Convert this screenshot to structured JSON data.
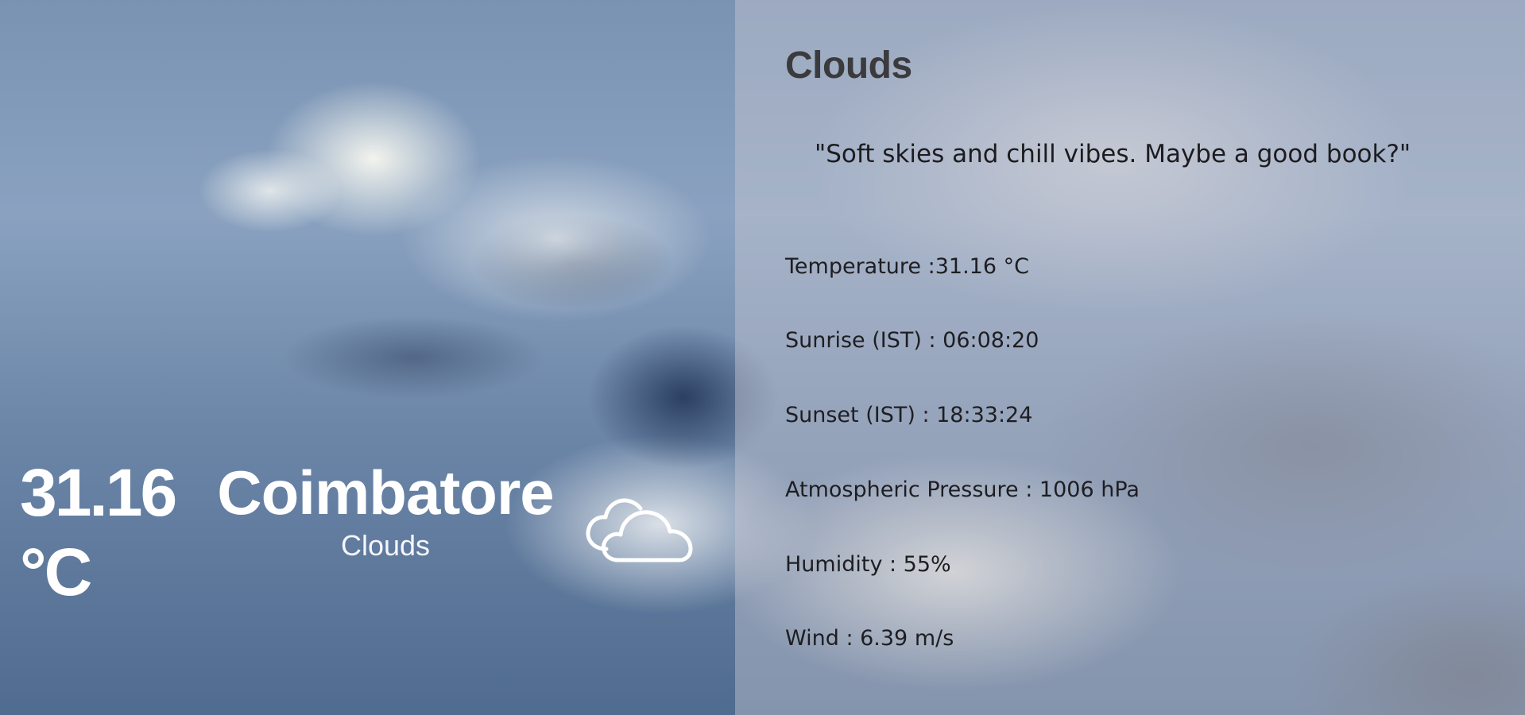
{
  "current": {
    "temperature": "31.16 °C",
    "city": "Coimbatore",
    "condition": "Clouds",
    "condition_icon": "cloud-icon"
  },
  "details": {
    "title": "Clouds",
    "quote": "\"Soft skies and chill vibes. Maybe a good book?\"",
    "stats": {
      "temperature": "Temperature :31.16 °C",
      "sunrise": "Sunrise (IST) : 06:08:20",
      "sunset": "Sunset (IST) : 18:33:24",
      "pressure": "Atmospheric Pressure : 1006 hPa",
      "humidity": "Humidity : 55%",
      "wind": "Wind : 6.39 m/s"
    }
  },
  "colors": {
    "overlay": "#c8c8d2",
    "title": "#3b3b3e",
    "text": "#1e1e22",
    "hero_text": "#ffffff"
  }
}
